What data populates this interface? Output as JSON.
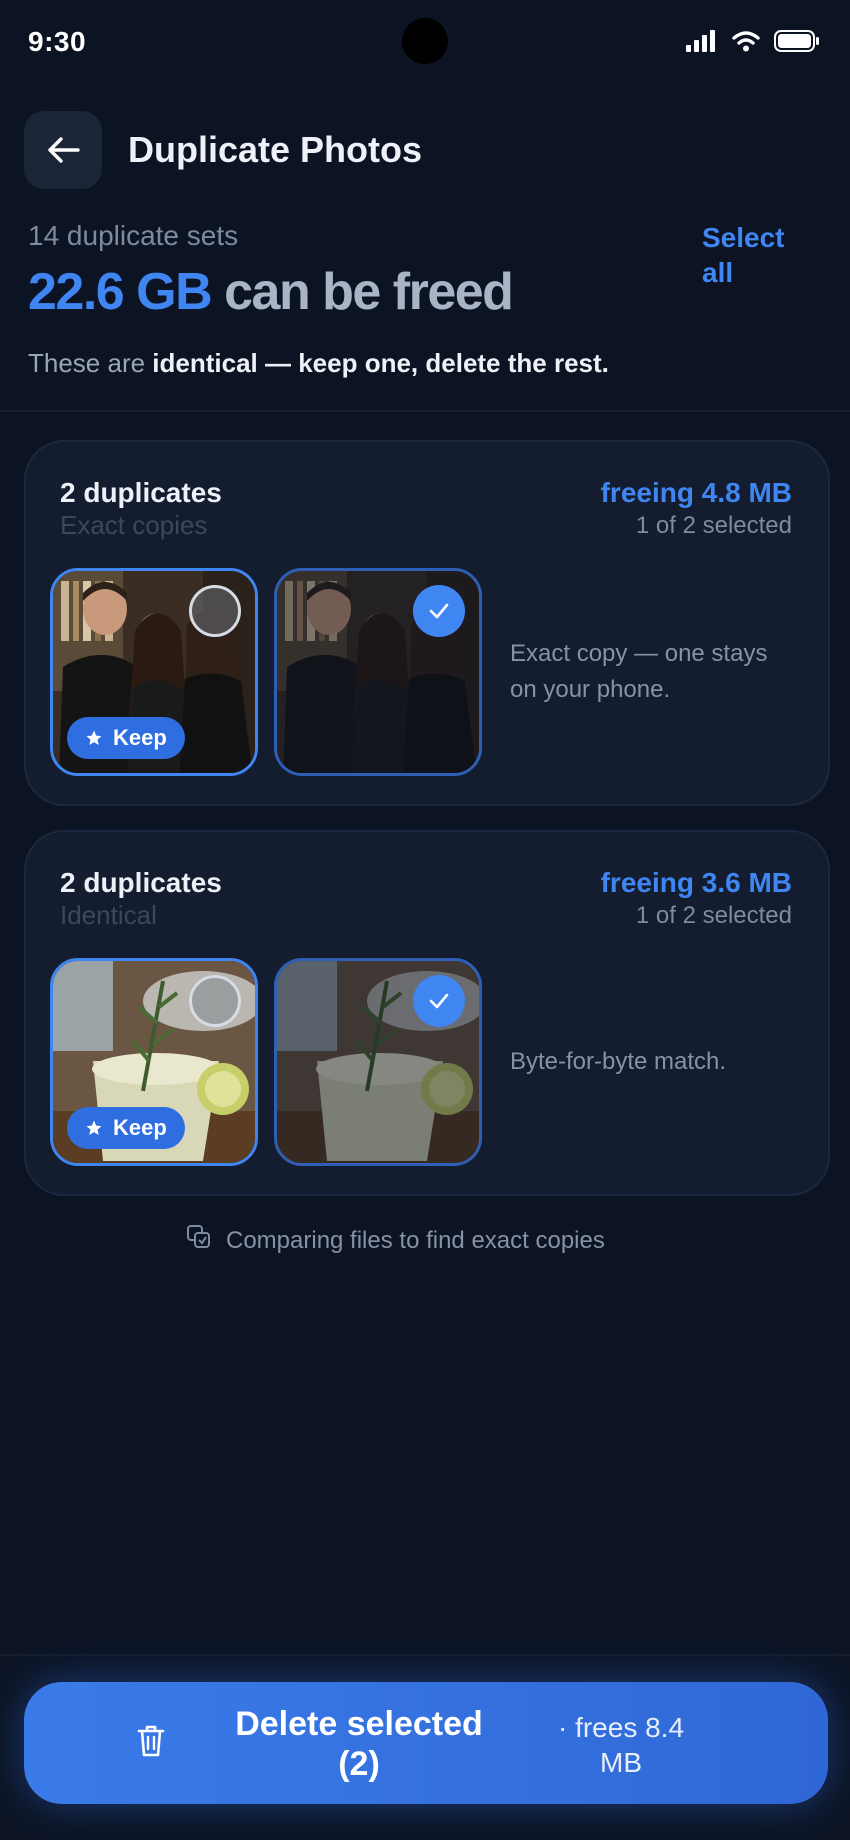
{
  "status_bar": {
    "time": "9:30"
  },
  "header": {
    "title": "Duplicate Photos"
  },
  "summary": {
    "sets": "14 duplicate sets",
    "amount": "22.6 GB",
    "amount_suffix": "can be freed",
    "select_all": "Select all",
    "note_prefix": "These are ",
    "note_bold": "identical — keep one, delete the rest."
  },
  "groups": [
    {
      "title": "2 duplicates",
      "subtitle": "Exact copies",
      "freeing": "freeing 4.8 MB",
      "selected": "1 of 2 selected",
      "keep_label": "Keep",
      "description": "Exact copy — one stays on your phone."
    },
    {
      "title": "2 duplicates",
      "subtitle": "Identical",
      "freeing": "freeing 3.6 MB",
      "selected": "1 of 2 selected",
      "keep_label": "Keep",
      "description": "Byte-for-byte match."
    }
  ],
  "info": {
    "text": "Comparing files to find exact copies"
  },
  "delete_button": {
    "label": "Delete selected (2)",
    "frees": "· frees 8.4 MB"
  },
  "colors": {
    "accent": "#3f86f2",
    "background": "#0c1424",
    "card": "#131d2f"
  }
}
